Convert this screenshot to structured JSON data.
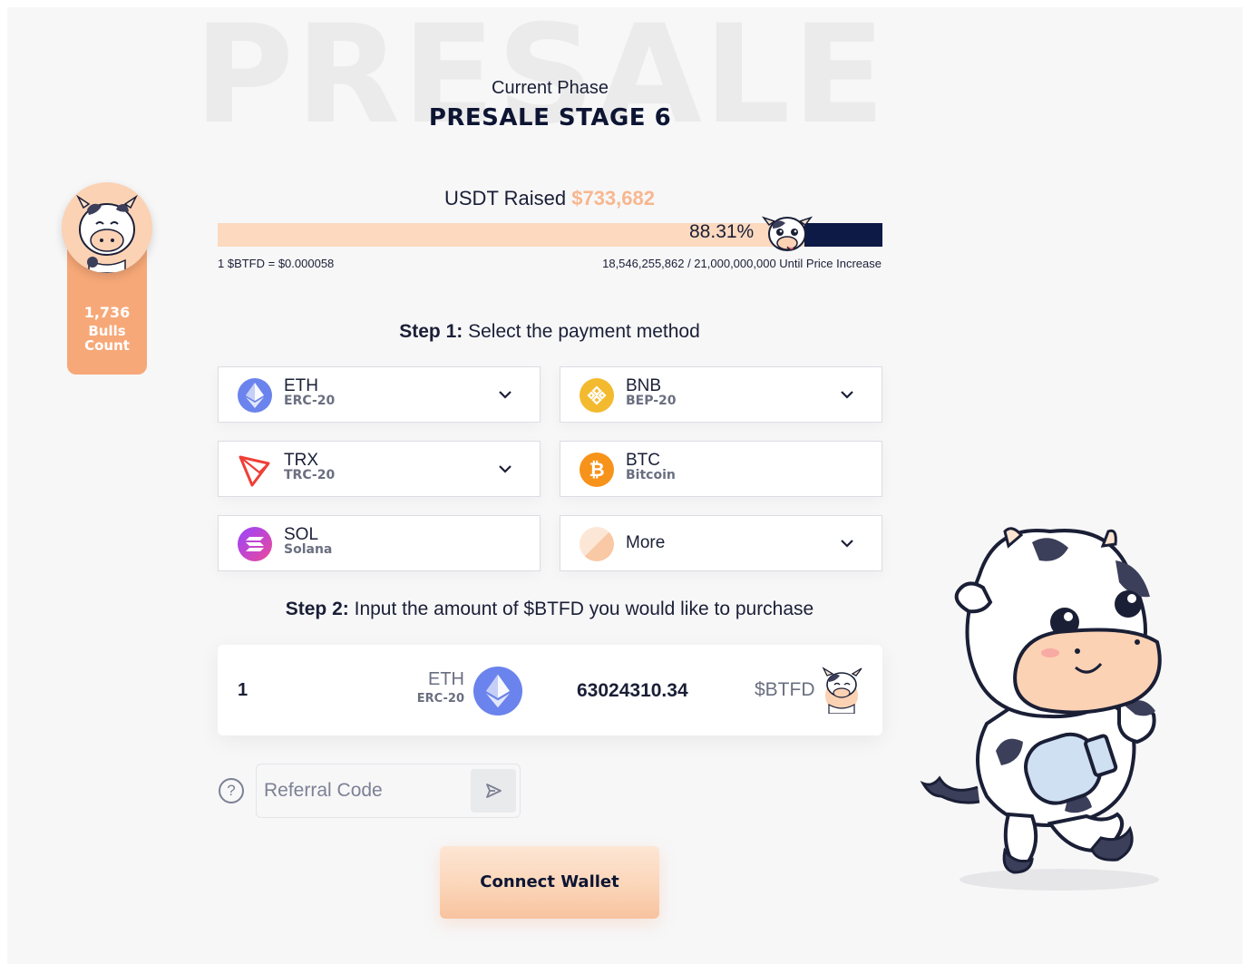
{
  "background_word": "PRESALE",
  "phase": {
    "label": "Current Phase",
    "title": "PRESALE STAGE 6"
  },
  "bulls": {
    "count": "1,736",
    "label_line1": "Bulls",
    "label_line2": "Count"
  },
  "raised": {
    "label": "USDT Raised",
    "amount": "$733,682"
  },
  "progress": {
    "percent_label": "88.31%",
    "fraction": 0.8831
  },
  "price": {
    "rate": "1 $BTFD = $0.000058",
    "until": "18,546,255,862 / 21,000,000,000 Until Price Increase"
  },
  "step1": {
    "bold": "Step 1:",
    "text": "Select the payment method"
  },
  "payment_methods": [
    {
      "name": "ETH",
      "network": "ERC-20",
      "icon": "ethereum-icon",
      "color": "#6b83ec",
      "has_dropdown": true
    },
    {
      "name": "BNB",
      "network": "BEP-20",
      "icon": "binance-icon",
      "color": "#f3ba2f",
      "has_dropdown": true
    },
    {
      "name": "TRX",
      "network": "TRC-20",
      "icon": "tron-icon",
      "color": "#ef3f37",
      "has_dropdown": true
    },
    {
      "name": "BTC",
      "network": "Bitcoin",
      "icon": "bitcoin-icon",
      "color": "#f7931a",
      "has_dropdown": false
    },
    {
      "name": "SOL",
      "network": "Solana",
      "icon": "solana-icon",
      "color": "#9945ff",
      "has_dropdown": false
    },
    {
      "name": "More",
      "network": "",
      "icon": "more-currencies-icon",
      "color": "#fbd4b6",
      "has_dropdown": true
    }
  ],
  "step2": {
    "bold": "Step 2:",
    "text": "Input the amount of $BTFD you would like to purchase"
  },
  "amount": {
    "input_value": "1",
    "currency": "ETH",
    "currency_network": "ERC-20",
    "output_value": "63024310.34",
    "output_token": "$BTFD"
  },
  "referral": {
    "placeholder": "Referral Code",
    "help_glyph": "?"
  },
  "connect_button": {
    "label": "Connect Wallet"
  },
  "colors": {
    "accent": "#f7a878",
    "navy": "#0d1a45",
    "progress_fill": "#fcd9bf",
    "background": "#f7f7f8"
  }
}
